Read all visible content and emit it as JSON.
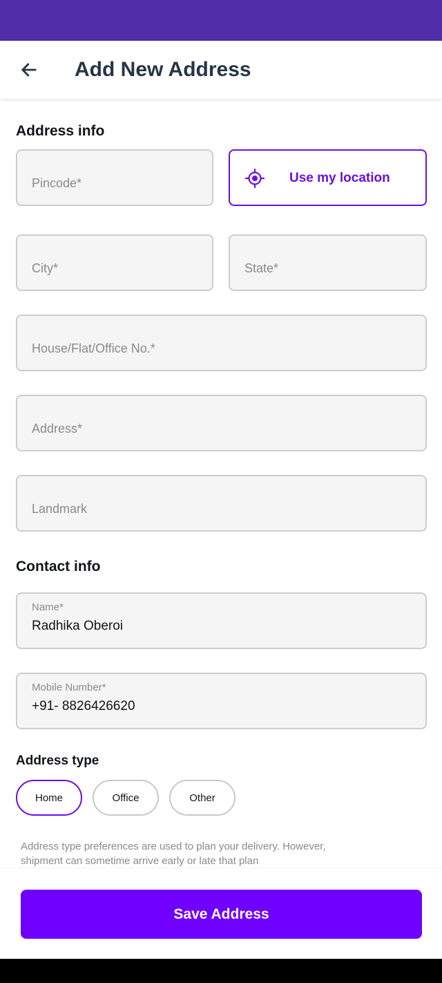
{
  "colors": {
    "status_bar": "#522da8",
    "accent": "#6a0fe6",
    "save_button": "#7000ff"
  },
  "header": {
    "back_icon": "arrow-left-icon",
    "title": "Add New Address"
  },
  "address_info": {
    "section_title": "Address info",
    "pincode_placeholder": "Pincode*",
    "use_location": {
      "icon": "crosshair-location-icon",
      "label": "Use my location"
    },
    "city_placeholder": "City*",
    "state_placeholder": "State*",
    "house_placeholder": "House/Flat/Office No.*",
    "address_placeholder": "Address*",
    "landmark_placeholder": "Landmark"
  },
  "contact_info": {
    "section_title": "Contact info",
    "name_label": "Name*",
    "name_value": "Radhika Oberoi",
    "mobile_label": "Mobile Number*",
    "mobile_value": "+91- 8826426620"
  },
  "address_type": {
    "section_title": "Address type",
    "options": [
      "Home",
      "Office",
      "Other"
    ],
    "selected": "Home",
    "note": "Address type preferences are used to plan your delivery. However, shipment can sometime arrive early or late that plan"
  },
  "footer": {
    "save_label": "Save Address"
  }
}
